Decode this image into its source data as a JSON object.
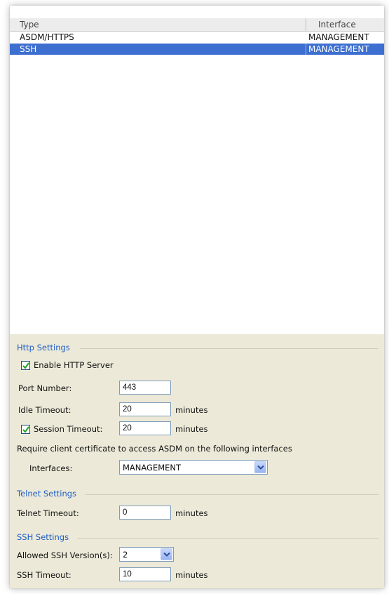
{
  "table": {
    "columns": [
      "Type",
      "Interface"
    ],
    "rows": [
      {
        "type": "ASDM/HTTPS",
        "interface": "MANAGEMENT",
        "selected": false
      },
      {
        "type": "SSH",
        "interface": "MANAGEMENT",
        "selected": true
      }
    ]
  },
  "http": {
    "group_title": "Http Settings",
    "enable_label": "Enable HTTP Server",
    "enable_checked": true,
    "port_label": "Port Number:",
    "port_value": "443",
    "idle_label": "Idle Timeout:",
    "idle_value": "20",
    "idle_unit": "minutes",
    "session_label": "Session Timeout:",
    "session_checked": true,
    "session_value": "20",
    "session_unit": "minutes",
    "cert_text": "Require client certificate to access ASDM on the following interfaces",
    "interfaces_label": "Interfaces:",
    "interfaces_value": "MANAGEMENT"
  },
  "telnet": {
    "group_title": "Telnet Settings",
    "timeout_label": "Telnet Timeout:",
    "timeout_value": "0",
    "timeout_unit": "minutes"
  },
  "ssh": {
    "group_title": "SSH Settings",
    "versions_label": "Allowed SSH Version(s):",
    "versions_value": "2",
    "timeout_label": "SSH Timeout:",
    "timeout_value": "10",
    "timeout_unit": "minutes"
  },
  "colors": {
    "selection": "#3d6fd0",
    "group_title": "#1e5ec7",
    "panel_bg": "#ece9d8"
  },
  "icons": [
    "checkmark-icon",
    "chevron-down-icon"
  ]
}
